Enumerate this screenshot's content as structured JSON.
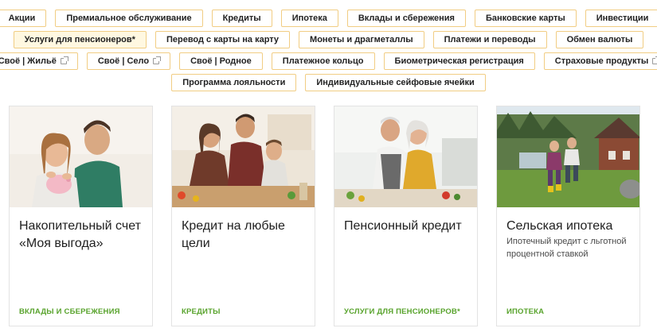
{
  "tags": {
    "row1": [
      {
        "label": "Акции"
      },
      {
        "label": "Премиальное обслуживание"
      },
      {
        "label": "Кредиты"
      },
      {
        "label": "Ипотека"
      },
      {
        "label": "Вклады и сбережения"
      },
      {
        "label": "Банковские карты"
      },
      {
        "label": "Инвестиции"
      }
    ],
    "row2": [
      {
        "label": "Услуги для пенсионеров*",
        "active": true
      },
      {
        "label": "Перевод с карты на карту"
      },
      {
        "label": "Монеты и драгметаллы"
      },
      {
        "label": "Платежи и переводы"
      },
      {
        "label": "Обмен валюты"
      }
    ],
    "row3": [
      {
        "label": "Своё | Жильё",
        "external": true
      },
      {
        "label": "Своё | Село",
        "external": true
      },
      {
        "label": "Своё | Родное"
      },
      {
        "label": "Платежное кольцо"
      },
      {
        "label": "Биометрическая регистрация"
      },
      {
        "label": "Страховые продукты",
        "external": true
      }
    ],
    "row4": [
      {
        "label": "Программа лояльности"
      },
      {
        "label": "Индивидуальные сейфовые ячейки"
      }
    ]
  },
  "cards": [
    {
      "title": "Накопительный счет «Моя выгода»",
      "subtitle": "",
      "category": "ВКЛАДЫ И СБЕРЕЖЕНИЯ"
    },
    {
      "title": "Кредит на любые цели",
      "subtitle": "",
      "category": "КРЕДИТЫ"
    },
    {
      "title": "Пенсионный кредит",
      "subtitle": "",
      "category": "УСЛУГИ ДЛЯ ПЕНСИОНЕРОВ*"
    },
    {
      "title": "Сельская ипотека",
      "subtitle": "Ипотечный кредит с льготной процентной ставкой",
      "category": "ИПОТЕКА"
    }
  ],
  "colors": {
    "tag_border": "#f1cd83",
    "category_green": "#58a32c",
    "card_border": "#e3e3e3"
  }
}
